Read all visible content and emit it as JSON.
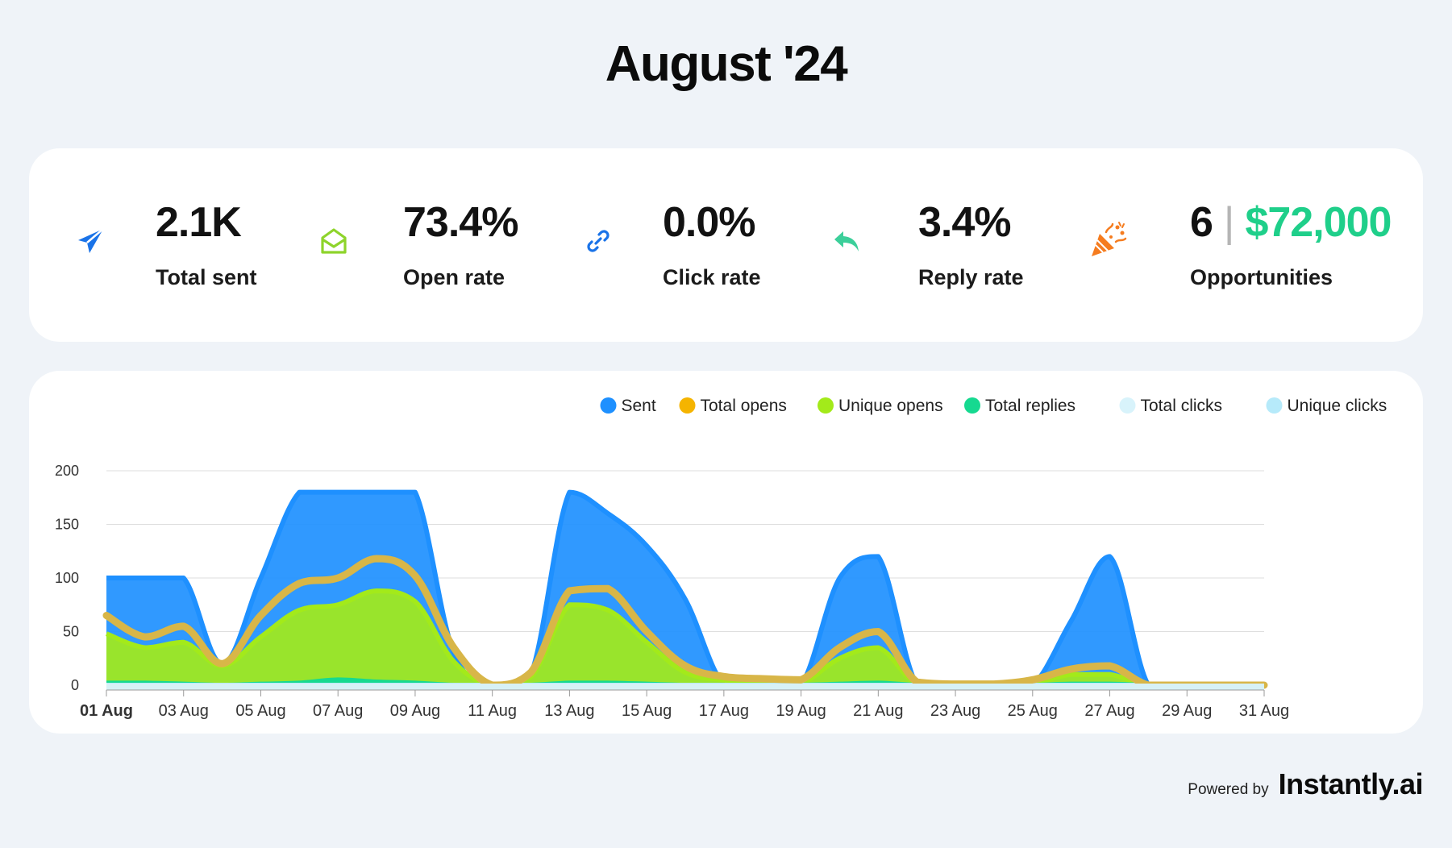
{
  "title": "August '24",
  "stats": [
    {
      "icon": "paper-plane-icon",
      "value": "2.1K",
      "label": "Total sent",
      "color": "#1a73e8"
    },
    {
      "icon": "open-envelope-icon",
      "value": "73.4%",
      "label": "Open rate",
      "color": "#8ed42b"
    },
    {
      "icon": "link-icon",
      "value": "0.0%",
      "label": "Click rate",
      "color": "#1a73e8"
    },
    {
      "icon": "reply-arrow-icon",
      "value": "3.4%",
      "label": "Reply rate",
      "color": "#3ccf9a"
    },
    {
      "icon": "party-popper-icon",
      "value": "6",
      "money": "$72,000",
      "label": "Opportunities",
      "color": "#f57c1f"
    }
  ],
  "chart_data": {
    "type": "area",
    "categories": [
      "01 Aug",
      "02 Aug",
      "03 Aug",
      "04 Aug",
      "05 Aug",
      "06 Aug",
      "07 Aug",
      "08 Aug",
      "09 Aug",
      "10 Aug",
      "11 Aug",
      "12 Aug",
      "13 Aug",
      "14 Aug",
      "15 Aug",
      "16 Aug",
      "17 Aug",
      "18 Aug",
      "19 Aug",
      "20 Aug",
      "21 Aug",
      "22 Aug",
      "23 Aug",
      "24 Aug",
      "25 Aug",
      "26 Aug",
      "27 Aug",
      "28 Aug",
      "29 Aug",
      "30 Aug",
      "31 Aug"
    ],
    "tick_labels": [
      "01 Aug",
      "03 Aug",
      "05 Aug",
      "07 Aug",
      "09 Aug",
      "11 Aug",
      "13 Aug",
      "15 Aug",
      "17 Aug",
      "19 Aug",
      "21 Aug",
      "23 Aug",
      "25 Aug",
      "27 Aug",
      "29 Aug",
      "31 Aug"
    ],
    "yticks": [
      0,
      50,
      100,
      150,
      200
    ],
    "ylim": [
      0,
      200
    ],
    "grid": true,
    "legend_position": "top-right",
    "series": [
      {
        "name": "Sent",
        "color": "#1e90ff",
        "style": "area",
        "values": [
          100,
          100,
          100,
          20,
          100,
          180,
          180,
          180,
          180,
          30,
          0,
          10,
          180,
          160,
          130,
          80,
          0,
          0,
          0,
          100,
          120,
          0,
          0,
          0,
          0,
          60,
          120,
          0,
          0,
          0,
          0
        ]
      },
      {
        "name": "Total opens",
        "color": "#f5b400",
        "style": "line",
        "values": [
          65,
          45,
          55,
          20,
          65,
          95,
          100,
          118,
          102,
          35,
          0,
          12,
          88,
          90,
          50,
          18,
          8,
          6,
          5,
          35,
          50,
          3,
          1,
          1,
          5,
          15,
          18,
          0,
          0,
          0,
          0
        ]
      },
      {
        "name": "Unique opens",
        "color": "#a3ea1a",
        "style": "area",
        "values": [
          48,
          35,
          40,
          18,
          45,
          70,
          75,
          88,
          78,
          22,
          0,
          8,
          75,
          70,
          40,
          12,
          5,
          3,
          2,
          25,
          35,
          1,
          0,
          0,
          2,
          10,
          10,
          0,
          0,
          0,
          0
        ]
      },
      {
        "name": "Total replies",
        "color": "#16d990",
        "style": "area",
        "values": [
          2,
          2,
          1,
          0,
          1,
          2,
          5,
          3,
          2,
          0,
          0,
          0,
          2,
          2,
          1,
          0,
          0,
          0,
          0,
          1,
          2,
          0,
          0,
          0,
          0,
          1,
          1,
          0,
          0,
          0,
          0
        ]
      },
      {
        "name": "Total clicks",
        "color": "#d8f3fb",
        "style": "area",
        "values": [
          0,
          0,
          0,
          0,
          0,
          0,
          0,
          0,
          0,
          0,
          0,
          0,
          0,
          0,
          0,
          0,
          0,
          0,
          0,
          0,
          0,
          0,
          0,
          0,
          0,
          0,
          0,
          0,
          0,
          0,
          0
        ]
      },
      {
        "name": "Unique clicks",
        "color": "#b6eafa",
        "style": "area",
        "values": [
          0,
          0,
          0,
          0,
          0,
          0,
          0,
          0,
          0,
          0,
          0,
          0,
          0,
          0,
          0,
          0,
          0,
          0,
          0,
          0,
          0,
          0,
          0,
          0,
          0,
          0,
          0,
          0,
          0,
          0,
          0
        ]
      }
    ]
  },
  "footer": {
    "powered_label": "Powered by",
    "brand": "Instantly.ai"
  }
}
